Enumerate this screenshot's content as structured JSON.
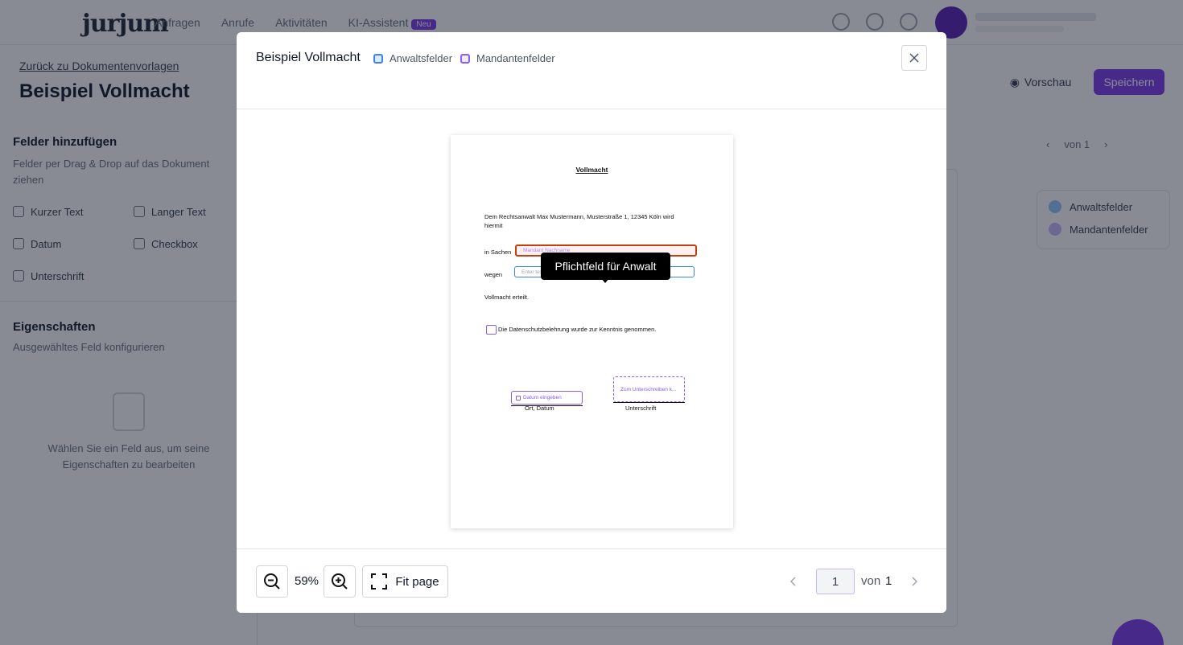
{
  "background": {
    "logo": "jurjum",
    "nav": [
      "Anfragen",
      "Anrufe",
      "Aktivitäten",
      "KI-Assistent"
    ],
    "nav_badge": "Neu",
    "back_link": "Zurück zu Dokumentenvorlagen",
    "page_heading": "Beispiel Vollmacht",
    "preview_button": "Vorschau",
    "save_button": "Speichern",
    "left_panel": {
      "title": "Felder hinzufügen",
      "subtitle": "Felder per Drag & Drop auf das Dokument ziehen",
      "fields": [
        "Kurzer Text",
        "Langer Text",
        "Datum",
        "Checkbox",
        "Unterschrift"
      ],
      "properties_title": "Eigenschaften",
      "properties_subtitle": "Ausgewähltes Feld konfigurieren",
      "empty_text": "Wählen Sie ein Feld aus, um seine Eigenschaften zu bearbeiten"
    },
    "right_pager": "von 1",
    "legend": [
      "Anwaltsfelder",
      "Mandantenfelder"
    ]
  },
  "modal": {
    "title": "Beispiel Vollmacht",
    "legend": [
      {
        "label": "Anwaltsfelder",
        "color": "#3b82f6"
      },
      {
        "label": "Mandantenfelder",
        "color": "#8b5cf6"
      }
    ],
    "document": {
      "heading": "Vollmacht",
      "line1": "Dem Rechtsanwalt Max Mustermann, Musterstraße 1, 12345 Köln wird",
      "line2": "hiermit",
      "in_sachen_label": "in Sachen",
      "in_sachen_placeholder": "Mandant Nachname",
      "wegen_label": "wegen",
      "wegen_placeholder": "Enter text",
      "closing": "Vollmacht erteilt.",
      "checkbox_text": "Die Datenschutzbelehrung wurde zur Kenntnis genommen.",
      "date_placeholder": "Datum eingeben",
      "date_caption": "Ort, Datum",
      "sign_placeholder": "Zum Unterschreiben k...",
      "sign_caption": "Unterschrift"
    },
    "tooltip": "Pflichtfeld für Anwalt",
    "footer": {
      "zoom": "59%",
      "fit_label": "Fit page",
      "page_current": "1",
      "page_of": "von",
      "page_total": "1"
    }
  }
}
